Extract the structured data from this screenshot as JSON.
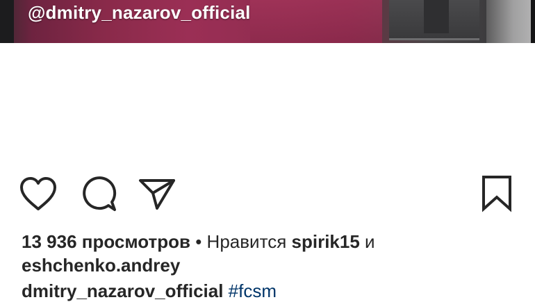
{
  "video": {
    "overlay_handle": "@dmitry_nazarov_official"
  },
  "actions": {
    "like_icon": "heart-outline-icon",
    "comment_icon": "speech-bubble-icon",
    "share_icon": "paper-plane-icon",
    "save_icon": "bookmark-outline-icon"
  },
  "stats": {
    "views_count": "13 936",
    "views_label": "просмотров",
    "separator": "•",
    "liked_by_prefix": "Нравится",
    "first_liker": "spirik15",
    "conjunction": "и",
    "second_liker": "eshchenko.andrey"
  },
  "caption": {
    "username": "dmitry_nazarov_official",
    "hashtag": "#fcsm"
  },
  "colors": {
    "text": "#262626",
    "hashtag": "#003569",
    "background": "#ffffff"
  }
}
